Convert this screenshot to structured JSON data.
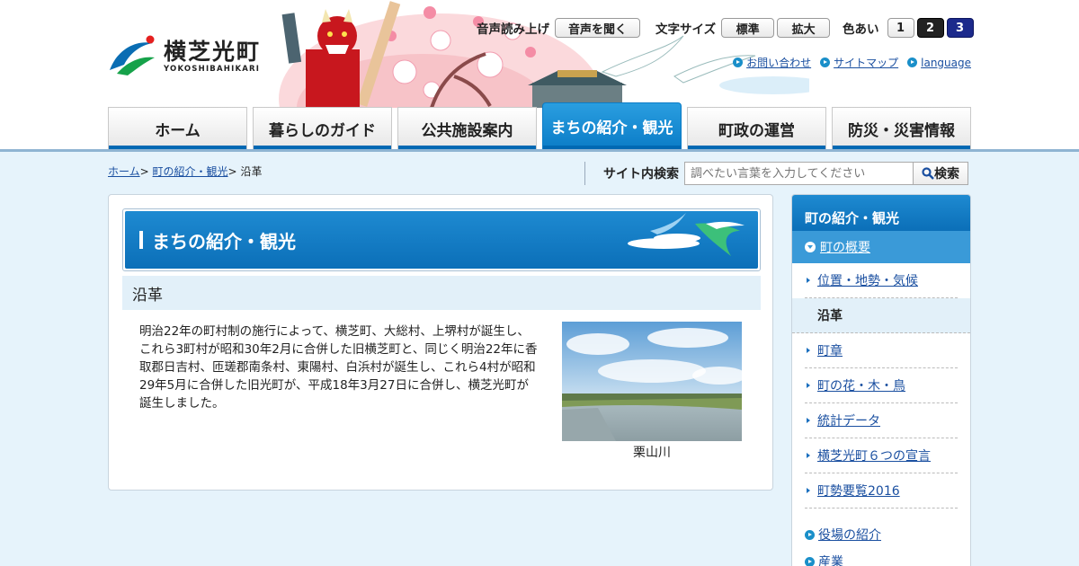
{
  "logo": {
    "name": "横芝光町",
    "romaji": "YOKOSHIBAHIKARI"
  },
  "util": {
    "speech_label": "音声読み上げ",
    "speech_button": "音声を聞く",
    "fontsize_label": "文字サイズ",
    "fontsize_normal": "標準",
    "fontsize_large": "拡大",
    "color_label": "色あい",
    "color_options": [
      "1",
      "2",
      "3"
    ]
  },
  "top_links": [
    "お問い合わせ",
    "サイトマップ",
    "language"
  ],
  "global_nav": [
    "ホーム",
    "暮らしのガイド",
    "公共施設案内",
    "まちの紹介・観光",
    "町政の運営",
    "防災・災害情報"
  ],
  "breadcrumb": {
    "home": "ホーム",
    "section": "町の紹介・観光",
    "current": "沿革",
    "sep": ">"
  },
  "search": {
    "label": "サイト内検索",
    "placeholder": "調べたい言葉を入力してください",
    "button": "検索"
  },
  "content": {
    "banner_title": "まちの紹介・観光",
    "heading": "沿革",
    "body": "明治22年の町村制の施行によって、横芝町、大総村、上堺村が誕生し、これら3町村が昭和30年2月に合併した旧横芝町と、同じく明治22年に香取郡日吉村、匝瑳郡南条村、東陽村、白浜村が誕生し、これら4村が昭和29年5月に合併した旧光町が、平成18年3月27日に合併し、横芝光町が誕生しました。",
    "photo_caption": "栗山川"
  },
  "sidebar": {
    "title": "町の紹介・観光",
    "selected": "町の概要",
    "items": [
      "位置・地勢・気候",
      "沿革",
      "町章",
      "町の花・木・鳥",
      "統計データ",
      "横芝光町６つの宣言",
      "町勢要覧2016"
    ],
    "current_index": 1,
    "sections": [
      "役場の紹介",
      "産業"
    ]
  },
  "colors": {
    "primary": "#0b6fb8",
    "accent": "#1e8ad1",
    "link": "#1a4fa0",
    "page_bg": "#e6f3fb"
  }
}
